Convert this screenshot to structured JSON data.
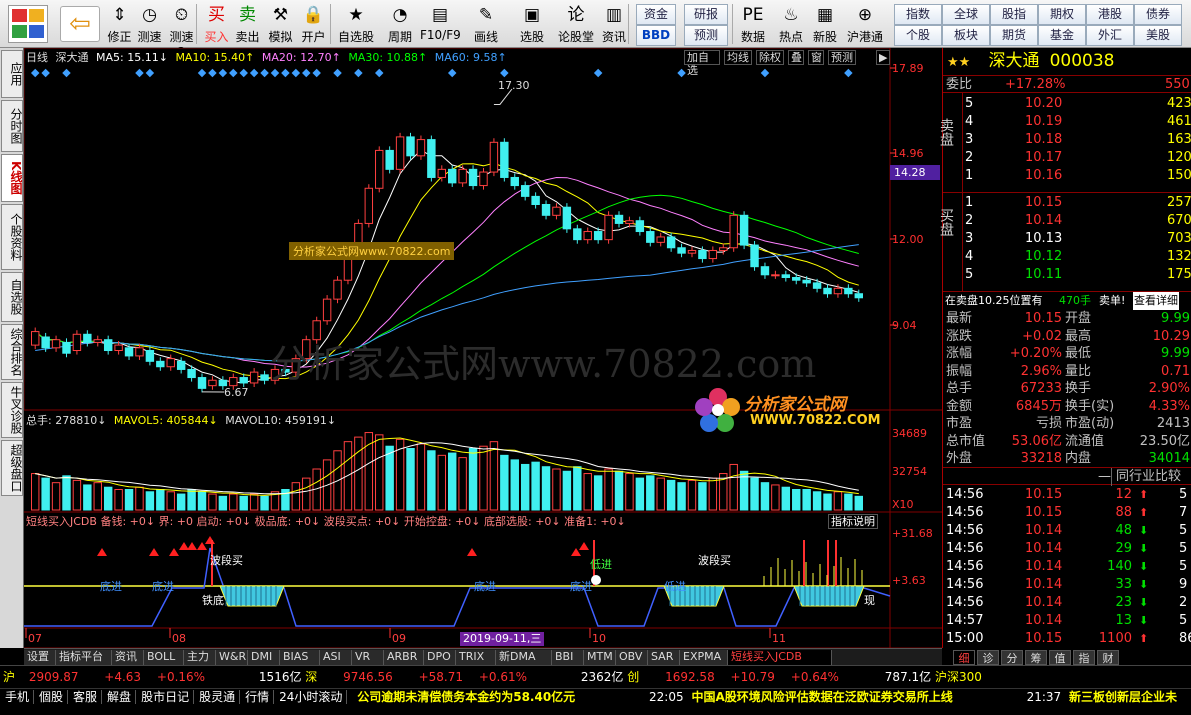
{
  "toolbar": {
    "buttons": [
      {
        "label": "修正",
        "icon": "⇕",
        "name": "fix-button"
      },
      {
        "label": "测速",
        "icon": "◷",
        "name": "speed-test-button"
      },
      {
        "label": "测速2",
        "icon": "⏲",
        "name": "timer-button"
      },
      {
        "label": "买入",
        "icon": "买",
        "name": "buy-button"
      },
      {
        "label": "卖出",
        "icon": "卖",
        "name": "sell-button"
      },
      {
        "label": "模拟",
        "icon": "⚒",
        "name": "simulate-button"
      },
      {
        "label": "开户",
        "icon": "🔒",
        "name": "open-account-button"
      },
      {
        "label": "自选股",
        "icon": "★",
        "name": "watchlist-button"
      },
      {
        "label": "周期",
        "icon": "◔",
        "name": "period-button"
      },
      {
        "label": "F10/F9",
        "icon": "▤",
        "name": "f10-button"
      },
      {
        "label": "画线",
        "icon": "✎",
        "name": "draw-line-button"
      },
      {
        "label": "选股",
        "icon": "▣",
        "name": "stock-pick-button"
      },
      {
        "label": "论股堂",
        "icon": "论",
        "name": "forum-button"
      },
      {
        "label": "资讯",
        "icon": "▥",
        "name": "news-button"
      },
      {
        "label": "数据",
        "icon": "PE",
        "name": "data-button"
      },
      {
        "label": "热点",
        "icon": "♨",
        "name": "hot-button"
      },
      {
        "label": "新股",
        "icon": "▦",
        "name": "new-stock-button"
      },
      {
        "label": "沪港通",
        "icon": "⊕",
        "name": "hk-connect-button"
      }
    ],
    "boxes": [
      "资金",
      "研报",
      "BBD",
      "预测"
    ],
    "right_grid": [
      [
        "指数",
        "全球",
        "股指",
        "期权",
        "港股",
        "债券"
      ],
      [
        "个股",
        "板块",
        "期货",
        "基金",
        "外汇",
        "美股"
      ]
    ]
  },
  "sidebar": {
    "tabs": [
      "应用",
      "分时图",
      "K线图",
      "个股资料",
      "自选股",
      "综合排名",
      "牛叉诊股",
      "超级盘口"
    ],
    "active": 2
  },
  "chart": {
    "header": {
      "type": "日线",
      "name": "深大通",
      "ma5": "MA5: 15.11↓",
      "ma10": "MA10: 15.40↑",
      "ma20": "MA20: 12.70↑",
      "ma30": "MA30: 10.88↑",
      "ma60": "MA60: 9.58↑"
    },
    "buttons": [
      "加自选",
      "均线",
      "除权",
      "叠",
      "窗",
      "预测",
      "▶"
    ],
    "price_axis": [
      "17.89",
      "14.96",
      "12.00",
      "9.04"
    ],
    "highlight_price": "14.28",
    "annotation_high": "17.30",
    "annotation_low": "6.67",
    "volume_legend": {
      "total": "总手: 278810↓",
      "mavol5": "MAVOL5: 405844↓",
      "mavol10": "MAVOL10: 459191↓"
    },
    "volume_axis": [
      "34689",
      "32754",
      "X10"
    ],
    "indicator_legend": "短线买入JCDB 备钱: +0↓ 界: +0 启动: +0↓ 极品底: +0↓ 波段买点: +0↓ 开始控盘: +0↓ 底部选股: +0↓ 准备1: +0↓",
    "indicator_button": "指标说明",
    "indicator_axis": [
      "+31.68",
      "+3.63"
    ],
    "indicator_labels": [
      "底进",
      "底进",
      "波段买",
      "铁底",
      "底进",
      "底进",
      "低进",
      "波段买",
      "低进",
      "现"
    ],
    "time_axis": [
      "07",
      "08",
      "09",
      "10",
      "11"
    ],
    "time_cursor": "2019-09-11,三",
    "watermark": "分析家公式网www.70822.com",
    "watermark_small": "分析家公式网www.70822.com",
    "logo_text": "分析家公式网",
    "logo_url": "WWW.70822.COM"
  },
  "chart_data": {
    "type": "candlestick",
    "xlabel": "",
    "ylabel": "",
    "ylim": [
      6.0,
      18.5
    ],
    "note_high": 17.3,
    "note_low": 6.67,
    "candles": [
      [
        8.4,
        8.9
      ],
      [
        8.7,
        8.3
      ],
      [
        8.3,
        8.6
      ],
      [
        8.5,
        8.1
      ],
      [
        8.2,
        8.8
      ],
      [
        8.8,
        8.5
      ],
      [
        8.5,
        8.6
      ],
      [
        8.6,
        8.2
      ],
      [
        8.2,
        8.4
      ],
      [
        8.3,
        8.0
      ],
      [
        8.0,
        8.3
      ],
      [
        8.2,
        7.8
      ],
      [
        7.8,
        7.6
      ],
      [
        7.6,
        7.9
      ],
      [
        7.8,
        7.5
      ],
      [
        7.5,
        7.2
      ],
      [
        7.2,
        6.8
      ],
      [
        6.9,
        7.1
      ],
      [
        7.1,
        6.9
      ],
      [
        6.9,
        7.2
      ],
      [
        7.2,
        7.0
      ],
      [
        7.0,
        7.4
      ],
      [
        7.3,
        7.1
      ],
      [
        7.1,
        7.5
      ],
      [
        7.5,
        7.4
      ],
      [
        7.4,
        7.9
      ],
      [
        7.9,
        8.6
      ],
      [
        8.6,
        9.3
      ],
      [
        9.3,
        10.1
      ],
      [
        10.1,
        10.8
      ],
      [
        10.8,
        11.7
      ],
      [
        11.7,
        12.9
      ],
      [
        12.9,
        14.2
      ],
      [
        14.2,
        15.6
      ],
      [
        15.6,
        14.9
      ],
      [
        14.9,
        16.1
      ],
      [
        16.1,
        15.4
      ],
      [
        15.4,
        16.0
      ],
      [
        16.0,
        14.6
      ],
      [
        14.6,
        14.9
      ],
      [
        14.9,
        14.4
      ],
      [
        14.4,
        14.9
      ],
      [
        14.9,
        14.3
      ],
      [
        14.3,
        14.8
      ],
      [
        14.8,
        15.9
      ],
      [
        15.9,
        14.6
      ],
      [
        14.6,
        14.3
      ],
      [
        14.3,
        13.9
      ],
      [
        13.9,
        13.6
      ],
      [
        13.6,
        13.2
      ],
      [
        13.2,
        13.5
      ],
      [
        13.5,
        12.7
      ],
      [
        12.7,
        12.3
      ],
      [
        12.3,
        12.6
      ],
      [
        12.6,
        12.3
      ],
      [
        12.3,
        13.2
      ],
      [
        13.2,
        12.9
      ],
      [
        12.9,
        13.0
      ],
      [
        13.0,
        12.6
      ],
      [
        12.6,
        12.2
      ],
      [
        12.2,
        12.4
      ],
      [
        12.4,
        12.0
      ],
      [
        12.0,
        11.8
      ],
      [
        11.8,
        11.9
      ],
      [
        11.9,
        11.6
      ],
      [
        11.6,
        11.9
      ],
      [
        11.9,
        12.0
      ],
      [
        12.0,
        13.2
      ],
      [
        13.2,
        12.1
      ],
      [
        12.1,
        11.3
      ],
      [
        11.3,
        11.0
      ],
      [
        11.0,
        11.0
      ],
      [
        11.0,
        10.9
      ],
      [
        10.9,
        10.8
      ],
      [
        10.8,
        10.7
      ],
      [
        10.7,
        10.5
      ],
      [
        10.5,
        10.3
      ],
      [
        10.3,
        10.5
      ],
      [
        10.5,
        10.3
      ],
      [
        10.3,
        10.15
      ]
    ],
    "volume": [
      16,
      14,
      12,
      15,
      13,
      11,
      12,
      10,
      9,
      9,
      10,
      8,
      9,
      8,
      7,
      9,
      8,
      7,
      6,
      7,
      6,
      7,
      6,
      8,
      9,
      12,
      14,
      18,
      22,
      26,
      30,
      32,
      34,
      33,
      28,
      31,
      27,
      29,
      26,
      24,
      25,
      23,
      27,
      28,
      30,
      24,
      22,
      20,
      21,
      19,
      18,
      17,
      19,
      16,
      15,
      18,
      17,
      16,
      14,
      15,
      14,
      13,
      12,
      13,
      12,
      14,
      16,
      20,
      17,
      14,
      12,
      11,
      10,
      9,
      9,
      8,
      7,
      8,
      7,
      6
    ],
    "ma_series": [
      {
        "name": "MA5",
        "color": "#ffffff"
      },
      {
        "name": "MA10",
        "color": "#ffff00"
      },
      {
        "name": "MA20",
        "color": "#ff80ff"
      },
      {
        "name": "MA30",
        "color": "#00ff00"
      },
      {
        "name": "MA60",
        "color": "#40a0ff"
      }
    ]
  },
  "quote": {
    "stars": "★★",
    "name": "深大通",
    "code": "000038",
    "weibi_label": "委比",
    "weibi": "+17.28%",
    "weibi_vol": "550",
    "sell_label": "卖盘",
    "buy_label": "买盘",
    "asks": [
      [
        "5",
        "10.20",
        "423"
      ],
      [
        "4",
        "10.19",
        "461"
      ],
      [
        "3",
        "10.18",
        "163"
      ],
      [
        "2",
        "10.17",
        "120"
      ],
      [
        "1",
        "10.16",
        "150"
      ]
    ],
    "bids": [
      [
        "1",
        "10.15",
        "257"
      ],
      [
        "2",
        "10.14",
        "670"
      ],
      [
        "3",
        "10.13",
        "703"
      ],
      [
        "4",
        "10.12",
        "132"
      ],
      [
        "5",
        "10.11",
        "175"
      ]
    ],
    "notice": "在卖盘10.25位置有",
    "notice_vol": "470手",
    "notice_tail": "卖单!",
    "notice_link": "查看详细",
    "stats": [
      [
        "最新",
        "10.15",
        "开盘",
        "9.99"
      ],
      [
        "涨跌",
        "+0.02",
        "最高",
        "10.29"
      ],
      [
        "涨幅",
        "+0.20%",
        "最低",
        "9.99"
      ],
      [
        "振幅",
        "2.96%",
        "量比",
        "0.71"
      ],
      [
        "总手",
        "67233",
        "换手",
        "2.90%"
      ],
      [
        "金额",
        "6845万",
        "换手(实)",
        "4.33%"
      ],
      [
        "市盈",
        "亏损",
        "市盈(动)",
        "2413"
      ],
      [
        "总市值",
        "53.06亿",
        "流通值",
        "23.50亿"
      ],
      [
        "外盘",
        "33218",
        "内盘",
        "34014"
      ]
    ],
    "compare_label": "同行业比较",
    "ticks": [
      [
        "14:56",
        "10.15",
        "12"
      ],
      [
        "14:56",
        "10.15",
        "88"
      ],
      [
        "14:56",
        "10.14",
        "48"
      ],
      [
        "14:56",
        "10.14",
        "29"
      ],
      [
        "14:56",
        "10.14",
        "140"
      ],
      [
        "14:56",
        "10.14",
        "33"
      ],
      [
        "14:56",
        "10.14",
        "23"
      ],
      [
        "14:57",
        "10.14",
        "13"
      ],
      [
        "15:00",
        "10.15",
        "1100"
      ]
    ],
    "tick_tail": [
      "5",
      "7",
      "5",
      "5",
      "5",
      "9",
      "2",
      "5",
      "86"
    ],
    "tabs": [
      "细",
      "诊",
      "分",
      "筹",
      "值",
      "指",
      "财"
    ]
  },
  "bottom_tabs": [
    "设置",
    "指标平台",
    "资讯",
    "BOLL",
    "主力",
    "W&R",
    "DMI",
    "BIAS",
    "ASI",
    "VR",
    "ARBR",
    "DPO",
    "TRIX",
    "新DMA",
    "BBI",
    "MTM",
    "OBV",
    "SAR",
    "EXPMA",
    "短线买入JCDB"
  ],
  "status": {
    "sh_label": "沪",
    "sh_index": "2909.87",
    "sh_change": "+4.63",
    "sh_pct": "+0.16%",
    "sh_amount": "1516亿",
    "sz_label": "深",
    "sz_index": "9746.56",
    "sz_change": "+58.71",
    "sz_pct": "+0.61%",
    "sz_amount": "2362亿",
    "cy_label": "创",
    "cy_index": "1692.58",
    "cy_change": "+10.79",
    "cy_pct": "+0.64%",
    "cy_amount": "787.1亿",
    "hs_label": "沪深300",
    "links": [
      "手机",
      "個股",
      "客服",
      "解盘",
      "股市日记",
      "股灵通",
      "行情",
      "24小时滚动"
    ],
    "news1": "公司逾期未清偿债务本金约为58.40亿元",
    "news2_time": "22:05",
    "news2": "中国A股环境风险评估数据在泛欧证券交易所上线",
    "news3_time": "21:37",
    "news3": "新三板创新层企业未"
  }
}
